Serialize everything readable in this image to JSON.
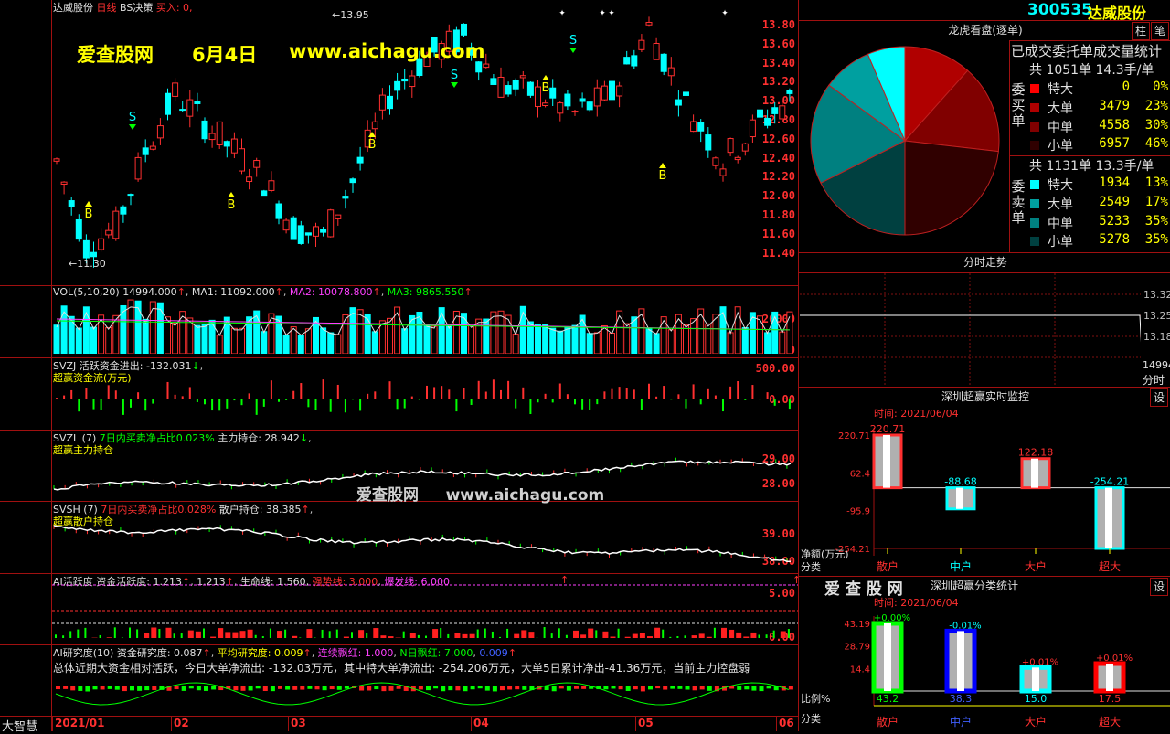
{
  "header": {
    "stock_name": "达威股份",
    "period": "日线",
    "indicator": "BS决策",
    "buy_in": "买入: 0,",
    "code": "300535",
    "code_name": "达威股份"
  },
  "watermark": {
    "site": "爱查股网",
    "date": "6月4日",
    "url": "www.aichagu.com",
    "center_site": "爱查股网",
    "center_url": "www.aichagu.com"
  },
  "main_chart": {
    "y_ticks": [
      "13.80",
      "13.60",
      "13.40",
      "13.20",
      "13.00",
      "12.80",
      "12.60",
      "12.40",
      "12.20",
      "12.00",
      "11.80",
      "11.60",
      "11.40"
    ],
    "high_label": "13.95",
    "low_label": "11.30",
    "buy_marker": "B",
    "sell_marker": "S"
  },
  "vol_panel": {
    "title": "VOL(5,10,20)",
    "vol": "14994.000",
    "ma1": "MA1: 11092.000",
    "ma2": "MA2: 10078.800",
    "ma3": "MA3: 9865.550",
    "y_ticks": [
      "20000",
      "0"
    ]
  },
  "svzj_panel": {
    "title": "SVZJ  活跃资金进出: -132.031",
    "subtitle": "超赢资金流(万元)",
    "y_ticks": [
      "500.00",
      "0.00"
    ]
  },
  "svzl_panel": {
    "title": "SVZL (7)",
    "ratio": "7日内买卖净占比0.023%",
    "hold": "主力持仓: 28.942",
    "subtitle": "超赢主力持仓",
    "y_ticks": [
      "29.00",
      "28.00"
    ]
  },
  "svsh_panel": {
    "title": "SVSH (7)",
    "ratio": "7日内买卖净占比0.028%",
    "hold": "散户持仓: 38.385",
    "subtitle": "超赢散户持仓",
    "y_ticks": [
      "39.00",
      "38.00"
    ]
  },
  "ai_active_panel": {
    "title": "AI活跃度 资金活跃度: 1.213",
    "v2": "1.213",
    "life": "生命线: 1.560,",
    "strong": "强势线: 3.000",
    "burst": "爆发线: 6.000",
    "y_ticks": [
      "5.00",
      "0.00"
    ]
  },
  "ai_research_panel": {
    "title": "AI研究度(10) 资金研究度: 0.087",
    "avg": "平均研究度: 0.009",
    "red": "连续飘红: 1.000",
    "nred": "N日飘红: 7.000",
    "last": "0.009",
    "summary": "总体近期大资金相对活跃，今日大单净流出: -132.03万元，其中特大单净流出: -254.206万元，大单5日累计净出-41.36万元，当前主力控盘弱"
  },
  "x_axis": [
    "2021/01",
    "02",
    "03",
    "04",
    "05",
    "06"
  ],
  "bottom_left": "大智慧",
  "pie_panel": {
    "title": "龙虎看盘(逐单)",
    "btn1": "柱",
    "btn2": "笔",
    "stats_title": "已成交委托单成交量统计",
    "buy_label": "委买单",
    "sell_label": "委卖单",
    "buy_total": "共 1051单 14.3手/单",
    "sell_total": "共 1131单 13.3手/单",
    "buy_rows": [
      {
        "name": "特大",
        "count": "0",
        "pct": "0%",
        "color": "#ff0000"
      },
      {
        "name": "大单",
        "count": "3479",
        "pct": "23%",
        "color": "#b00000"
      },
      {
        "name": "中单",
        "count": "4558",
        "pct": "30%",
        "color": "#800000"
      },
      {
        "name": "小单",
        "count": "6957",
        "pct": "46%",
        "color": "#300000"
      }
    ],
    "sell_rows": [
      {
        "name": "特大",
        "count": "1934",
        "pct": "13%",
        "color": "#00ffff"
      },
      {
        "name": "大单",
        "count": "2549",
        "pct": "17%",
        "color": "#00a0a0"
      },
      {
        "name": "中单",
        "count": "5233",
        "pct": "35%",
        "color": "#008080"
      },
      {
        "name": "小单",
        "count": "5278",
        "pct": "35%",
        "color": "#004040"
      }
    ]
  },
  "intraday_panel": {
    "title": "分时走势",
    "y_ticks": [
      "13.32",
      "13.25",
      "13.18"
    ],
    "vol": "14994",
    "label": "分时"
  },
  "monitor_panel": {
    "title": "深圳超赢实时监控",
    "setting": "设",
    "time": "时间: 2021/06/04",
    "y_ticks": [
      "220.71",
      "62.4",
      "-95.9",
      "-254.21"
    ],
    "unit": "净额(万元)",
    "cat_label": "分类",
    "categories": [
      "散户",
      "中户",
      "大户",
      "超大"
    ],
    "values": [
      220.71,
      -88.68,
      122.18,
      -254.21
    ],
    "value_labels": [
      "220.71",
      "-88.68",
      "122.18",
      "-254.21"
    ]
  },
  "class_panel": {
    "brand": "爱 查 股 网",
    "title": "深圳超赢分类统计",
    "setting": "设",
    "time": "时间: 2021/06/04",
    "y_ticks": [
      "43.19",
      "28.79",
      "14.4"
    ],
    "ratio_label": "比例%",
    "cat_label": "分类",
    "categories": [
      "散户",
      "中户",
      "大户",
      "超大"
    ],
    "values": [
      43.2,
      38.3,
      15.0,
      17.5
    ],
    "value_labels": [
      "43.2",
      "38.3",
      "15.0",
      "17.5"
    ],
    "change_labels": [
      "+0.00%",
      "-0.01%",
      "+0.01%",
      "+0.01%"
    ],
    "colors": [
      "#00ff00",
      "#0000ff",
      "#00ffff",
      "#ff0000"
    ]
  }
}
